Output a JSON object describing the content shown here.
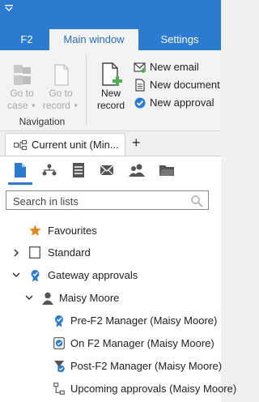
{
  "ribbon_tabs": {
    "f2": "F2",
    "main_window": "Main window",
    "settings": "Settings"
  },
  "ribbon": {
    "go_to_case": {
      "line1": "Go to",
      "line2": "case"
    },
    "go_to_record": {
      "line1": "Go to",
      "line2": "record"
    },
    "navigation_group": "Navigation",
    "new_record": {
      "line1": "New",
      "line2": "record"
    },
    "new_email": "New email",
    "new_document": "New document",
    "new_approval": "New approval"
  },
  "unit_tab": {
    "label": "Current unit (Min...",
    "add": "+"
  },
  "panel_icons": [
    "documents-icon",
    "hierarchy-icon",
    "list-icon",
    "mail-icon",
    "contacts-icon",
    "folder-icon"
  ],
  "search": {
    "placeholder": "Search in lists",
    "value": ""
  },
  "tree": {
    "favourites": "Favourites",
    "standard": "Standard",
    "gateway_approvals": "Gateway approvals",
    "maisy_moore": "Maisy Moore",
    "pre_f2": "Pre-F2 Manager (Maisy Moore)",
    "on_f2": "On F2 Manager (Maisy Moore)",
    "post_f2": "Post-F2 Manager (Maisy Moore)",
    "upcoming": "Upcoming approvals (Maisy Moore)"
  },
  "colors": {
    "accent": "#2b7bd1",
    "star": "#e08a1e",
    "green": "#4caf50"
  }
}
